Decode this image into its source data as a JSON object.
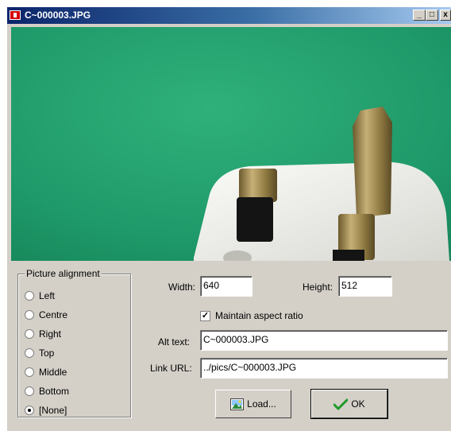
{
  "window": {
    "title": "C~000003.JPG",
    "buttons": {
      "minimize": "_",
      "maximize": "□",
      "close": "x"
    }
  },
  "alignment": {
    "label": "Picture alignment",
    "options": [
      "Left",
      "Centre",
      "Right",
      "Top",
      "Middle",
      "Bottom",
      "[None]"
    ],
    "selected": "[None]"
  },
  "size": {
    "width_label": "Width:",
    "width_value": "640",
    "height_label": "Height:",
    "height_value": "512",
    "aspect_label": "Maintain aspect ratio",
    "aspect_checked": true
  },
  "alt": {
    "label": "Alt text:",
    "value": "C~000003.JPG"
  },
  "link": {
    "label": "Link URL:",
    "value": "../pics/C~000003.JPG"
  },
  "actions": {
    "load_label": "Load...",
    "ok_label": "OK"
  },
  "colors": {
    "title_start": "#0a246a",
    "title_end": "#a6caf0",
    "dialog": "#d4d0c8",
    "photo_bg": "#1f9a6a"
  },
  "icons": [
    "window-icon",
    "minimize-icon",
    "maximize-icon",
    "close-icon",
    "load-picture-icon",
    "checkmark-icon"
  ]
}
